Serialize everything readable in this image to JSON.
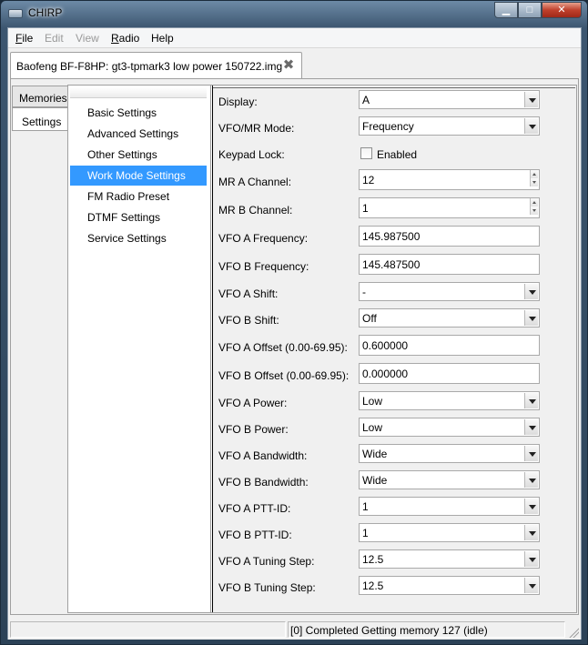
{
  "window": {
    "title": "CHIRP",
    "controls": {
      "minimize": "▁",
      "maximize": "□",
      "close": "✕"
    }
  },
  "menubar": {
    "items": [
      {
        "label": "File",
        "underline": "F",
        "rest": "ile",
        "enabled": true
      },
      {
        "label": "Edit",
        "enabled": false
      },
      {
        "label": "View",
        "enabled": false
      },
      {
        "label": "Radio",
        "underline": "R",
        "rest": "adio",
        "enabled": true
      },
      {
        "label": "Help",
        "enabled": true
      }
    ]
  },
  "document_tab": {
    "label": "Baofeng BF-F8HP: gt3-tpmark3 low power 150722.img",
    "close_icon": "close-icon"
  },
  "side_tabs": [
    {
      "label": "Memories",
      "active": false
    },
    {
      "label": "Settings",
      "active": true
    }
  ],
  "tree": {
    "items": [
      {
        "label": "Basic Settings",
        "selected": false
      },
      {
        "label": "Advanced Settings",
        "selected": false
      },
      {
        "label": "Other Settings",
        "selected": false
      },
      {
        "label": "Work Mode Settings",
        "selected": true
      },
      {
        "label": "FM Radio Preset",
        "selected": false
      },
      {
        "label": "DTMF Settings",
        "selected": false
      },
      {
        "label": "Service Settings",
        "selected": false
      }
    ],
    "selected_color": "#3399ff"
  },
  "form": {
    "rows": [
      {
        "label": "Display:",
        "type": "dropdown",
        "value": "A"
      },
      {
        "label": "VFO/MR Mode:",
        "type": "dropdown",
        "value": "Frequency"
      },
      {
        "label": "Keypad Lock:",
        "type": "checkbox",
        "value": "Enabled",
        "checked": false
      },
      {
        "label": "MR A Channel:",
        "type": "spinner",
        "value": "12"
      },
      {
        "label": "MR B Channel:",
        "type": "spinner",
        "value": "1"
      },
      {
        "label": "VFO A Frequency:",
        "type": "text",
        "value": "145.987500"
      },
      {
        "label": "VFO B Frequency:",
        "type": "text",
        "value": "145.487500"
      },
      {
        "label": "VFO A Shift:",
        "type": "dropdown",
        "value": "-"
      },
      {
        "label": "VFO B Shift:",
        "type": "dropdown",
        "value": "Off"
      },
      {
        "label": "VFO A Offset (0.00-69.95):",
        "type": "text",
        "value": "0.600000"
      },
      {
        "label": "VFO B Offset (0.00-69.95):",
        "type": "text",
        "value": "0.000000"
      },
      {
        "label": "VFO A Power:",
        "type": "dropdown",
        "value": "Low"
      },
      {
        "label": "VFO B Power:",
        "type": "dropdown",
        "value": "Low"
      },
      {
        "label": "VFO A Bandwidth:",
        "type": "dropdown",
        "value": "Wide"
      },
      {
        "label": "VFO B Bandwidth:",
        "type": "dropdown",
        "value": "Wide"
      },
      {
        "label": "VFO A PTT-ID:",
        "type": "dropdown",
        "value": "1"
      },
      {
        "label": "VFO B PTT-ID:",
        "type": "dropdown",
        "value": "1"
      },
      {
        "label": "VFO A Tuning Step:",
        "type": "dropdown",
        "value": "12.5"
      },
      {
        "label": "VFO B Tuning Step:",
        "type": "dropdown",
        "value": "12.5"
      }
    ]
  },
  "statusbar": {
    "left": "",
    "right": "[0] Completed Getting memory 127 (idle)"
  }
}
